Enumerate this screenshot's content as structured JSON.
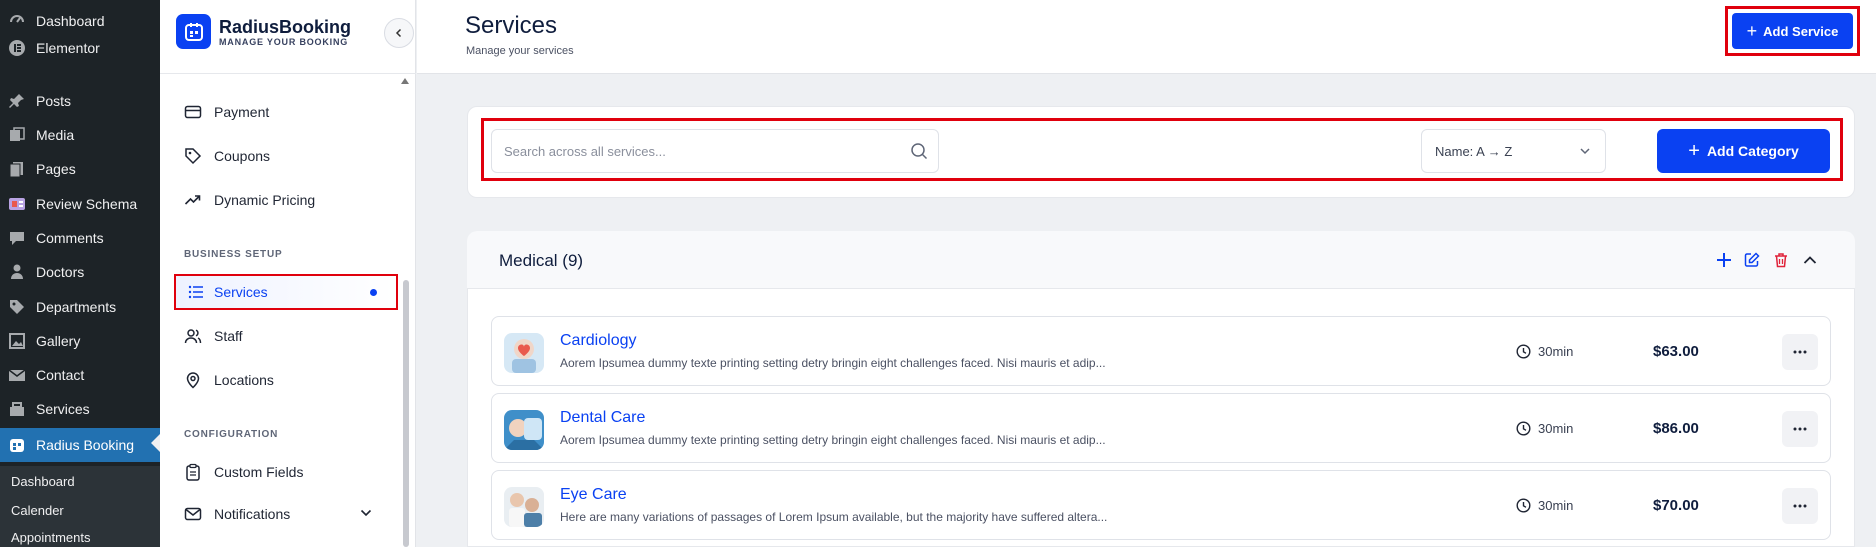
{
  "wp_menu": {
    "items": [
      {
        "label": "Dashboard",
        "icon": "dashboard-icon"
      },
      {
        "label": "Elementor",
        "icon": "elementor-icon"
      },
      {
        "label": "Posts",
        "icon": "pushpin-icon"
      },
      {
        "label": "Media",
        "icon": "media-icon"
      },
      {
        "label": "Pages",
        "icon": "pages-icon"
      },
      {
        "label": "Review Schema",
        "icon": "review-schema-icon"
      },
      {
        "label": "Comments",
        "icon": "comment-icon"
      },
      {
        "label": "Doctors",
        "icon": "person-icon"
      },
      {
        "label": "Departments",
        "icon": "tag-icon"
      },
      {
        "label": "Gallery",
        "icon": "gallery-icon"
      },
      {
        "label": "Contact",
        "icon": "mail-icon"
      },
      {
        "label": "Services",
        "icon": "services-icon"
      },
      {
        "label": "Radius Booking",
        "icon": "radius-booking-icon"
      }
    ],
    "submenu": [
      "Dashboard",
      "Calender",
      "Appointments"
    ]
  },
  "brand": {
    "name": "RadiusBooking",
    "tagline": "MANAGE YOUR BOOKING"
  },
  "nav": {
    "partial_item": "",
    "items_top": [
      {
        "label": "Payment",
        "icon": "credit-card-icon"
      },
      {
        "label": "Coupons",
        "icon": "coupon-tag-icon"
      },
      {
        "label": "Dynamic Pricing",
        "icon": "trending-up-icon"
      }
    ],
    "section_business": "BUSINESS SETUP",
    "services_label": "Services",
    "items_business": [
      {
        "label": "Staff",
        "icon": "users-icon"
      },
      {
        "label": "Locations",
        "icon": "map-pin-icon"
      }
    ],
    "section_config": "CONFIGURATION",
    "items_config": [
      {
        "label": "Custom Fields",
        "icon": "clipboard-icon"
      },
      {
        "label": "Notifications",
        "icon": "mail-icon"
      }
    ]
  },
  "header": {
    "title": "Services",
    "subtitle": "Manage your services",
    "add_service_label": "Add Service"
  },
  "toolbar": {
    "search_placeholder": "Search across all services...",
    "sort_value": "Name: A → Z",
    "add_category_label": "Add Category"
  },
  "category": {
    "title": "Medical (9)",
    "actions": [
      "plus-icon",
      "edit-icon",
      "trash-icon",
      "chevron-up-icon"
    ],
    "colors": {
      "add": "#0a41f2",
      "edit": "#0a41f2",
      "delete": "#e0233a"
    }
  },
  "services": [
    {
      "name": "Cardiology",
      "description": "Aorem Ipsumea dummy texte printing setting detry bringin eight challenges faced. Nisi mauris et adip...",
      "duration": "30min",
      "price": "$63.00",
      "thumb": "cardiology-thumbnail"
    },
    {
      "name": "Dental Care",
      "description": "Aorem Ipsumea dummy texte printing setting detry bringin eight challenges faced. Nisi mauris et adip...",
      "duration": "30min",
      "price": "$86.00",
      "thumb": "dental-care-thumbnail"
    },
    {
      "name": "Eye Care",
      "description": "Here are many variations of passages of Lorem Ipsum available, but the majority have suffered altera...",
      "duration": "30min",
      "price": "$70.00",
      "thumb": "eye-care-thumbnail"
    }
  ],
  "colors": {
    "primary": "#0a41f2",
    "highlight_border": "#e0000d",
    "wp_sidebar": "#1d2327",
    "wp_active": "#2271b1"
  }
}
